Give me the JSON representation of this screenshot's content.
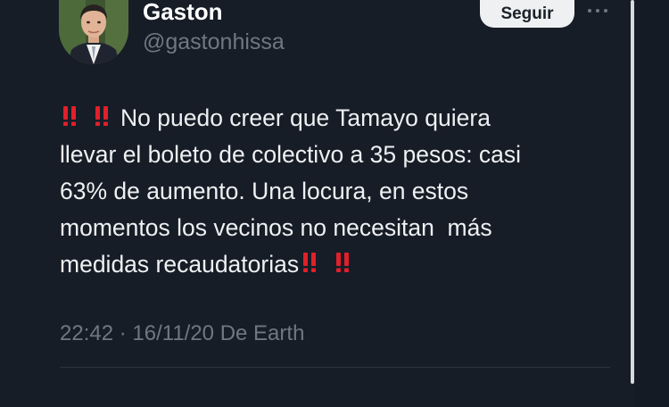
{
  "author": {
    "name": "Gaston",
    "handle": "@gastonhissa",
    "avatar_icon": "profile-photo-man-in-suit"
  },
  "actions": {
    "follow_label": "Seguir",
    "more_icon": "more-options-icon"
  },
  "tweet": {
    "lines": [
      "No puedo creer que Tamayo quiera",
      "llevar el boleto de colectivo a 35 pesos: casi",
      "63% de aumento. Una locura, en estos",
      "momentos los vecinos no necesitan  más",
      "medidas recaudatorias"
    ],
    "emoji": "double-exclamation-mark-icon",
    "emoji_color": "#e0202a"
  },
  "meta": {
    "time": "22:42",
    "separator": " · ",
    "date": "16/11/20",
    "source": " De Earth"
  },
  "colors": {
    "background": "#161d27",
    "text": "#eef0f2",
    "secondary_text": "#6f7882",
    "button_bg": "#eef0f2"
  }
}
